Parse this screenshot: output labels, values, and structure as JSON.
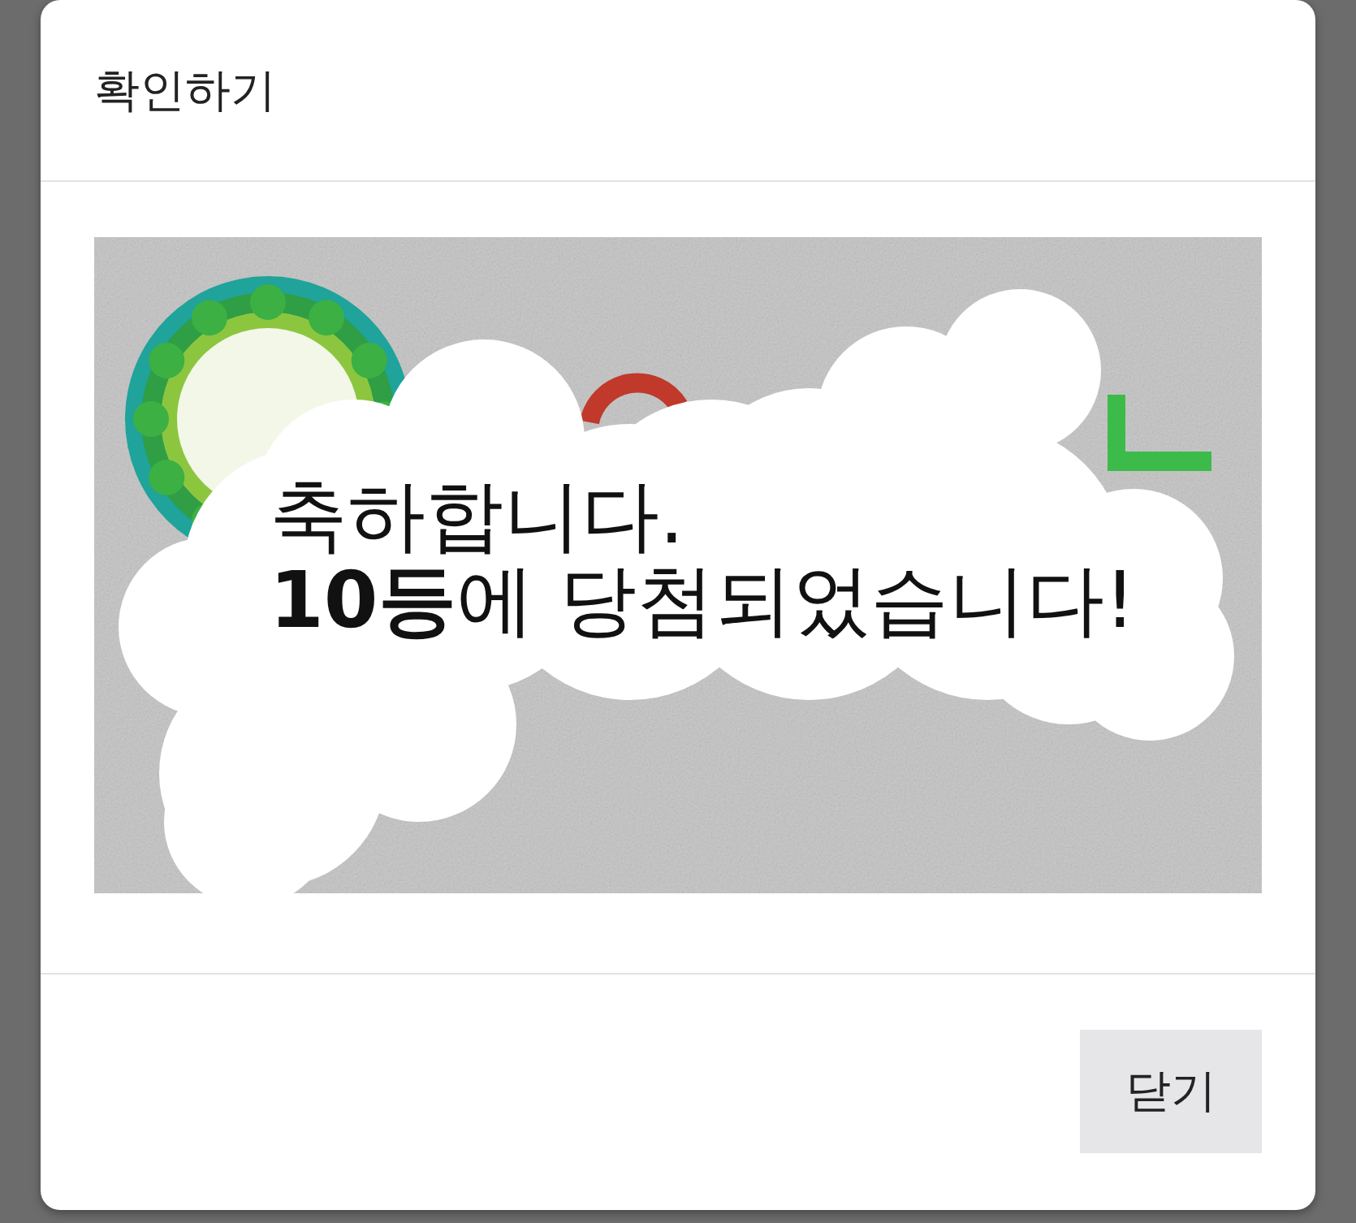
{
  "dialog": {
    "title": "확인하기"
  },
  "scratch_card": {
    "message": [
      "축하합니다.",
      "**10등**에 당첨되었습니다!"
    ]
  },
  "buttons": [
    {
      "label": "닫기"
    }
  ]
}
